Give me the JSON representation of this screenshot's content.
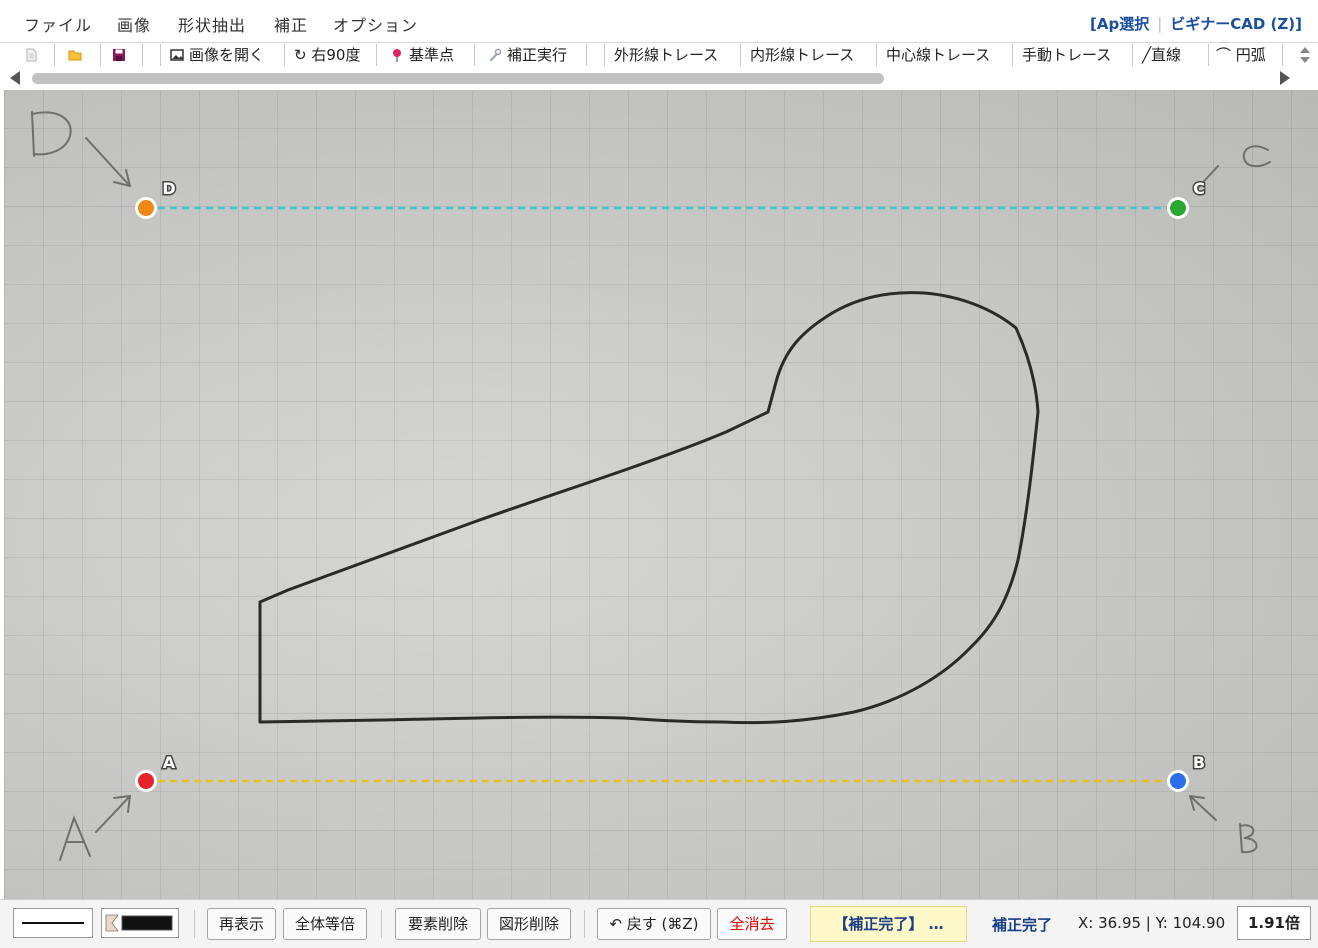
{
  "menu": {
    "items": [
      "ファイル",
      "画像",
      "形状抽出",
      "補正",
      "オプション"
    ],
    "ap_select": "[Ap選択",
    "beginner_cad": "ビギナーCAD (Z)]"
  },
  "toolbar": {
    "open_image": "画像を開く",
    "rotate": "右90度",
    "reference_point": "基準点",
    "run_correction": "補正実行",
    "outer_trace": "外形線トレース",
    "inner_trace": "内形線トレース",
    "center_trace": "中心線トレース",
    "manual_trace": "手動トレース",
    "line": "直線",
    "arc": "円弧",
    "line_icon": "╱",
    "arc_icon": "⌒",
    "rotate_icon": "↻"
  },
  "canvas": {
    "points": {
      "A": {
        "label": "A",
        "color": "#e8222b"
      },
      "B": {
        "label": "B",
        "color": "#2a6fe8"
      },
      "C": {
        "label": "C",
        "color": "#2aa632"
      },
      "D": {
        "label": "D",
        "color": "#f08a12"
      }
    },
    "line_top_color": "#3fc6d6",
    "line_bottom_color": "#e9c21a"
  },
  "statusbar": {
    "redisplay": "再表示",
    "fit_all": "全体等倍",
    "delete_element": "要素削除",
    "delete_shape": "図形削除",
    "undo": "↶ 戻す (⌘Z)",
    "clear_all": "全消去",
    "status_message": "【補正完了】 …",
    "status_text": "補正完了",
    "coords": "X: 36.95 | Y: 104.90",
    "zoom": "1.91倍"
  }
}
